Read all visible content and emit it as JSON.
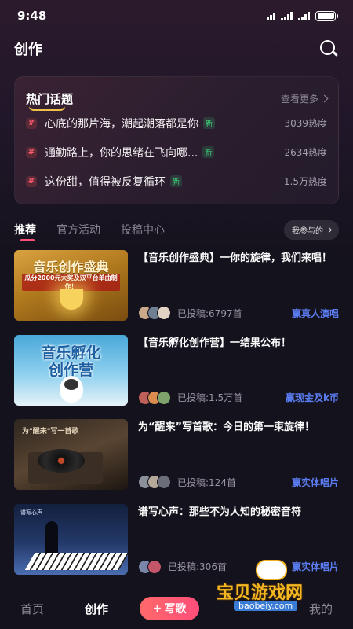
{
  "status_bar": {
    "time": "9:48"
  },
  "header": {
    "title": "创作"
  },
  "hot_topics": {
    "title": "热门话题",
    "more_label": "查看更多",
    "items": [
      {
        "icon": "#",
        "text": "心底的那片海，潮起潮落都是你",
        "badge": "新",
        "heat": "3039热度"
      },
      {
        "icon": "#",
        "text": "通勤路上，你的思绪在飞向哪...",
        "badge": "新",
        "heat": "2634热度"
      },
      {
        "icon": "#",
        "text": "这份甜，值得被反复循环",
        "badge": "新",
        "heat": "1.5万热度"
      }
    ]
  },
  "tabs": {
    "items": [
      "推荐",
      "官方活动",
      "投稿中心"
    ],
    "active": 0,
    "participate_label": "我参与的"
  },
  "feed": [
    {
      "thumb_lines": [
        "音乐创作盛典",
        "瓜分2000元大奖及双平台单曲制作！"
      ],
      "title": "【音乐创作盛典】一你的旋律，我们来唱！",
      "submitted": "已投稿:6797首",
      "reward": "赢真人演唱"
    },
    {
      "thumb_lines": [
        "音乐孵化",
        "创作营"
      ],
      "title": "【音乐孵化创作营】一结果公布！",
      "submitted": "已投稿:1.5万首",
      "reward": "赢现金及k币"
    },
    {
      "thumb_lines": [
        "为\"醒来\"写一首歌"
      ],
      "title": "为“醒来”写首歌：今日的第一束旋律！",
      "submitted": "已投稿:124首",
      "reward": "赢实体唱片"
    },
    {
      "thumb_lines": [
        "谱写心声"
      ],
      "title": "谱写心声：那些不为人知的秘密音符",
      "submitted": "已投稿:306首",
      "reward": "赢实体唱片"
    }
  ],
  "bottom_nav": {
    "home": "首页",
    "create": "创作",
    "compose": "写歌",
    "compose_icon": "+",
    "mine": "我的"
  },
  "watermark": {
    "text": "宝贝游戏网",
    "url": "baobeiy.com"
  },
  "colors": {
    "accent": "#ff4f7a",
    "reward": "#5b7cf0",
    "new_badge": "#3fd47e",
    "background": "#14121c"
  }
}
